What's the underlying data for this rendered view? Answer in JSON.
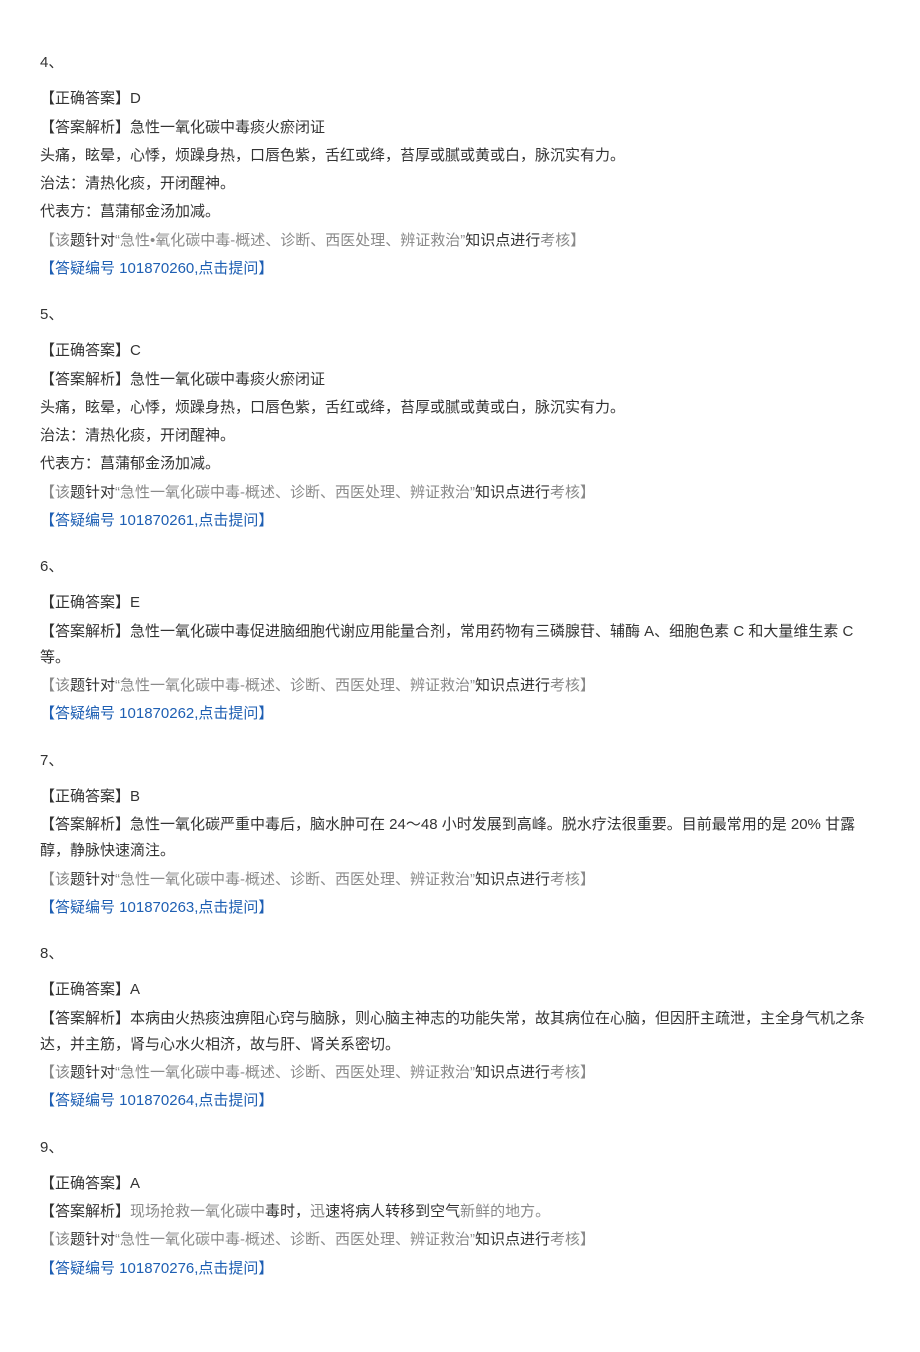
{
  "questions": [
    {
      "num": "4、",
      "answer_label": "【正确答案】D",
      "explanation_lines": [
        "【答案解析】急性一氧化碳中毒痰火瘀闭证",
        "头痛，眩晕，心悸，烦躁身热，口唇色紫，舌红或绛，苔厚或腻或黄或白，脉沉实有力。",
        "治法：清热化痰，开闭醒神。",
        "代表方：菖蒲郁金汤加减。"
      ],
      "knowledge_pre": "【该",
      "knowledge_mid_blk1": "题针对",
      "knowledge_quote": "“急性•氧化碳中毒-概述、诊断、西医处理、辨证救治”",
      "knowledge_mid_blk2": "知识点进行",
      "knowledge_post": "考核】",
      "qa_link": "【答疑编号 101870260,点击提问】"
    },
    {
      "num": "5、",
      "answer_label": "【正确答案】C",
      "explanation_lines": [
        "【答案解析】急性一氧化碳中毒痰火瘀闭证",
        "头痛，眩晕，心悸，烦躁身热，口唇色紫，舌红或绛，苔厚或腻或黄或白，脉沉实有力。",
        "治法：清热化痰，开闭醒神。",
        "代表方：菖蒲郁金汤加减。"
      ],
      "knowledge_pre": "【该",
      "knowledge_mid_blk1": "题针对",
      "knowledge_quote": "“急性一氧化碳中毒-概述、诊断、西医处理、辨证救治”",
      "knowledge_mid_blk2": "知识点进行",
      "knowledge_post": "考核】",
      "qa_link": "【答疑编号 101870261,点击提问】"
    },
    {
      "num": "6、",
      "answer_label": "【正确答案】E",
      "explanation_lines": [
        "【答案解析】急性一氧化碳中毒促进脑细胞代谢应用能量合剂，常用药物有三磷腺苷、辅酶 A、细胞色素 C 和大量维生素 C 等。"
      ],
      "knowledge_pre": "【该",
      "knowledge_mid_blk1": "题针对",
      "knowledge_quote": "“急性一氧化碳中毒-概述、诊断、西医处理、辨证救治”",
      "knowledge_mid_blk2": "知识点进行",
      "knowledge_post": "考核】",
      "qa_link": "【答疑编号 101870262,点击提问】"
    },
    {
      "num": "7、",
      "answer_label": "【正确答案】B",
      "explanation_lines": [
        "【答案解析】急性一氧化碳严重中毒后，脑水肿可在 24～48 小时发展到高峰。脱水疗法很重要。目前最常用的是 20% 甘露醇，静脉快速滴注。"
      ],
      "knowledge_pre": "【该",
      "knowledge_mid_blk1": "题针对",
      "knowledge_quote": "“急性一氧化碳中毒-概述、诊断、西医处理、辨证救治”",
      "knowledge_mid_blk2": "知识点进行",
      "knowledge_post": "考核】",
      "qa_link": "【答疑编号 101870263,点击提问】"
    },
    {
      "num": "8、",
      "answer_label": "【正确答案】A",
      "explanation_lines": [
        "【答案解析】本病由火热痰浊痹阻心窍与脑脉，则心脑主神志的功能失常，故其病位在心脑，但因肝主疏泄，主全身气机之条达，并主筋，肾与心水火相济，故与肝、肾关系密切。"
      ],
      "knowledge_pre": "【该",
      "knowledge_mid_blk1": "题针对",
      "knowledge_quote": "“急性一氧化碳中毒-概述、诊断、西医处理、辨证救治”",
      "knowledge_mid_blk2": "知识点进行",
      "knowledge_post": "考核】",
      "qa_link": "【答疑编号 101870264,点击提问】"
    },
    {
      "num": "9、",
      "answer_label": "【正确答案】A",
      "explanation_custom": {
        "parts": [
          {
            "t": "【答案解析】",
            "c": "regular"
          },
          {
            "t": "现场抢救一氧化碳中",
            "c": "grey"
          },
          {
            "t": "毒时，",
            "c": "regular"
          },
          {
            "t": "迅",
            "c": "grey"
          },
          {
            "t": "速将病",
            "c": "regular"
          },
          {
            "t": "人转移到空气",
            "c": "regular"
          },
          {
            "t": "新鲜的地方。",
            "c": "grey"
          }
        ]
      },
      "knowledge_pre": "【该",
      "knowledge_mid_blk1": "题针对",
      "knowledge_quote": "“急性一氧化碳中毒-概述、诊断、西医处理、辨证救治”",
      "knowledge_mid_blk2": "知识点进行",
      "knowledge_post": "考核】",
      "qa_link": "【答疑编号 101870276,点击提问】"
    }
  ]
}
